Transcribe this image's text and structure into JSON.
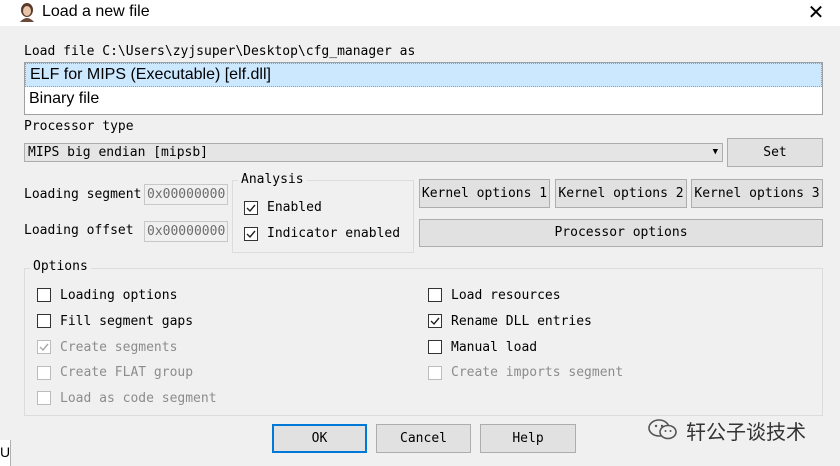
{
  "window": {
    "title": "Load a new file",
    "close_glyph": "✕"
  },
  "load_file": {
    "label": "Load file C:\\Users\\zyjsuper\\Desktop\\cfg_manager as",
    "options": [
      "ELF for MIPS (Executable) [elf.dll]",
      "Binary file"
    ],
    "selected_index": 0
  },
  "processor": {
    "label": "Processor type",
    "value": "MIPS big endian [mipsb]",
    "set_button": "Set"
  },
  "loading": {
    "segment_label": "Loading segment",
    "segment_value": "0x00000000",
    "offset_label": "Loading offset",
    "offset_value": "0x00000000"
  },
  "analysis": {
    "title": "Analysis",
    "enabled_label": "Enabled",
    "enabled_checked": true,
    "indicator_label": "Indicator enabled",
    "indicator_checked": true
  },
  "kernel_buttons": [
    "Kernel options 1",
    "Kernel options 2",
    "Kernel options 3"
  ],
  "processor_options_button": "Processor options",
  "options": {
    "title": "Options",
    "left": [
      {
        "label": "Loading options",
        "checked": false,
        "disabled": false
      },
      {
        "label": "Fill segment gaps",
        "checked": false,
        "disabled": false
      },
      {
        "label": "Create segments",
        "checked": true,
        "disabled": true
      },
      {
        "label": "Create FLAT group",
        "checked": false,
        "disabled": true
      },
      {
        "label": "Load as code segment",
        "checked": false,
        "disabled": true
      }
    ],
    "right": [
      {
        "label": "Load resources",
        "checked": false,
        "disabled": false
      },
      {
        "label": "Rename DLL entries",
        "checked": true,
        "disabled": false
      },
      {
        "label": "Manual load",
        "checked": false,
        "disabled": false
      },
      {
        "label": "Create imports segment",
        "checked": false,
        "disabled": true
      }
    ]
  },
  "buttons": {
    "ok": "OK",
    "cancel": "Cancel",
    "help": "Help"
  },
  "watermark": "轩公子谈技术",
  "background_window_fragment": "Us",
  "colors": {
    "selection": "#cce8ff",
    "primary_border": "#0078d7",
    "disabled_text": "#8c8c8c"
  }
}
